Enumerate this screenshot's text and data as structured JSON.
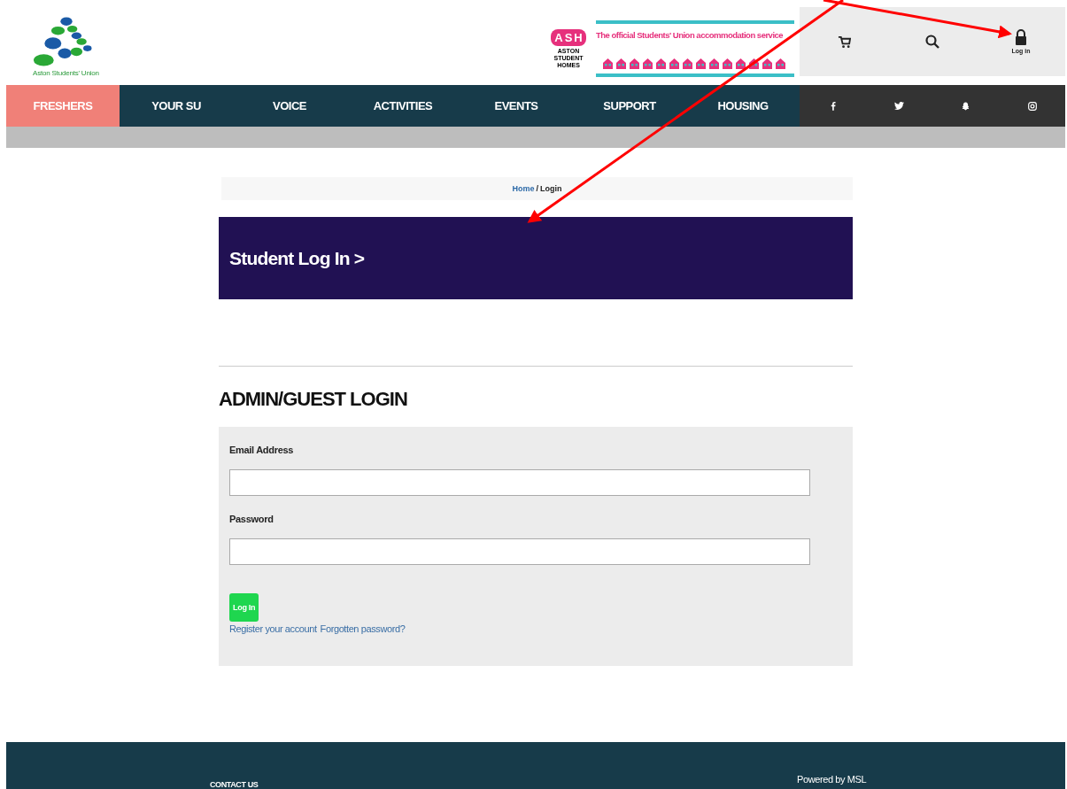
{
  "logo": {
    "caption": "Aston Students' Union"
  },
  "partner": {
    "badge_letters": [
      "A",
      "S",
      "H"
    ],
    "name": "ASTON STUDENT HOMES",
    "tagline": "The official Students' Union accommodation service"
  },
  "header_tools": [
    {
      "kind": "cart"
    },
    {
      "kind": "search"
    },
    {
      "kind": "login",
      "label": "Log in"
    }
  ],
  "nav": [
    {
      "label": "FRESHERS",
      "selected": true
    },
    {
      "label": "YOUR SU",
      "selected": false
    },
    {
      "label": "VOICE",
      "selected": false
    },
    {
      "label": "ACTIVITIES",
      "selected": false
    },
    {
      "label": "EVENTS",
      "selected": false
    },
    {
      "label": "SUPPORT",
      "selected": false
    },
    {
      "label": "HOUSING",
      "selected": false
    }
  ],
  "social": [
    {
      "kind": "facebook"
    },
    {
      "kind": "twitter"
    },
    {
      "kind": "snapchat"
    },
    {
      "kind": "instagram"
    }
  ],
  "breadcrumb": [
    {
      "label": "Home",
      "kind": "link"
    },
    {
      "label": "/",
      "kind": "separator"
    },
    {
      "label": "Login",
      "kind": "current"
    }
  ],
  "student_banner": {
    "title": "Student Log In >"
  },
  "admin_login": {
    "heading": "ADMIN/GUEST LOGIN",
    "fields": [
      {
        "label": "Email Address"
      },
      {
        "label": "Password"
      }
    ],
    "submit": "Log In",
    "links": [
      "Register your account",
      "Forgotten password?"
    ]
  },
  "footer": {
    "contact": "CONTACT US",
    "powered": "Powered by MSL"
  }
}
